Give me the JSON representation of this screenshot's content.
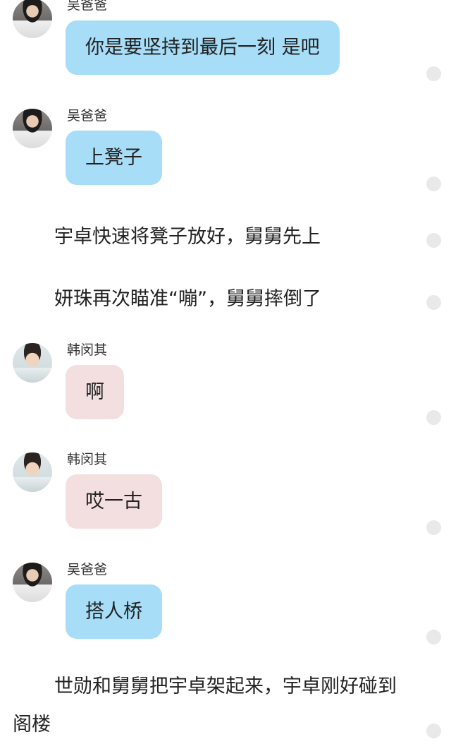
{
  "messages": [
    {
      "type": "chat",
      "sender": "吴爸爸",
      "text": "你是要坚持到最后一刻 是吧",
      "bubble_color": "#a7ddf7"
    },
    {
      "type": "chat",
      "sender": "吴爸爸",
      "text": "上凳子",
      "bubble_color": "#a7ddf7"
    },
    {
      "type": "narration",
      "text": "宇卓快速将凳子放好，舅舅先上"
    },
    {
      "type": "narration",
      "text": "妍珠再次瞄准“嘣”，舅舅摔倒了"
    },
    {
      "type": "chat",
      "sender": "韩闵其",
      "text": "啊",
      "bubble_color": "#f3dfe0"
    },
    {
      "type": "chat",
      "sender": "韩闵其",
      "text": "哎一古",
      "bubble_color": "#f3dfe0"
    },
    {
      "type": "chat",
      "sender": "吴爸爸",
      "text": "搭人桥",
      "bubble_color": "#a7ddf7"
    },
    {
      "type": "narration",
      "text": "世勋和舅舅把宇卓架起来，宇卓刚好碰到阁楼"
    }
  ],
  "icons": {
    "avatar_wu": "avatar-photo-wu-baba",
    "avatar_han": "avatar-photo-han-minqi",
    "message_dot": "gray-dot-icon"
  }
}
